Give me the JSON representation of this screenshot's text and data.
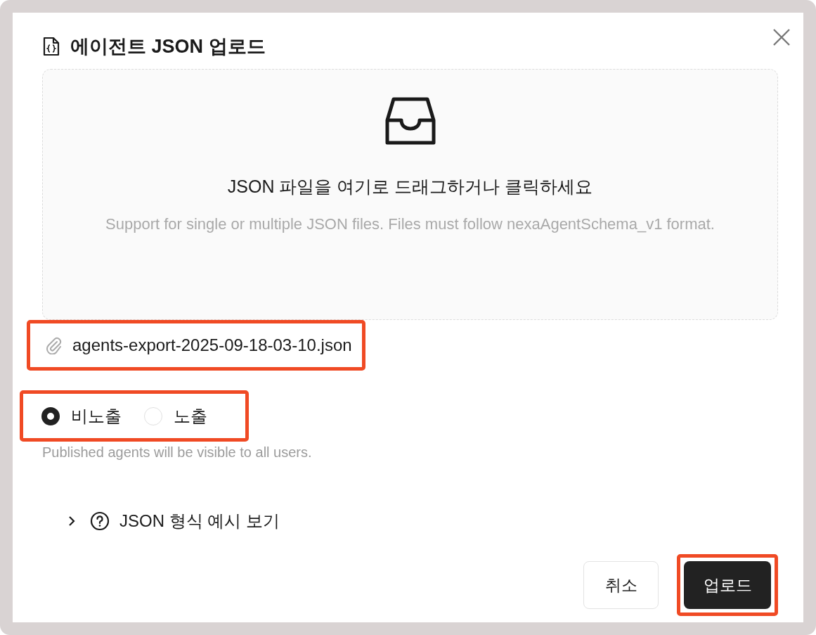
{
  "dialog": {
    "title": "에이전트 JSON 업로드"
  },
  "dropzone": {
    "title": "JSON 파일을 여기로 드래그하거나 클릭하세요",
    "hint": "Support for single or multiple JSON files. Files must follow nexaAgentSchema_v1 format."
  },
  "file": {
    "name": "agents-export-2025-09-18-03-10.json",
    "highlighted": true
  },
  "visibility": {
    "highlighted": true,
    "options": [
      {
        "label": "비노출",
        "selected": true
      },
      {
        "label": "노출",
        "selected": false
      }
    ],
    "help": "Published agents will be visible to all users."
  },
  "example": {
    "label": "JSON 형식 예시 보기",
    "expanded": false
  },
  "buttons": [
    {
      "label": "취소",
      "kind": "secondary",
      "highlighted": false
    },
    {
      "label": "업로드",
      "kind": "primary",
      "highlighted": true
    }
  ]
}
